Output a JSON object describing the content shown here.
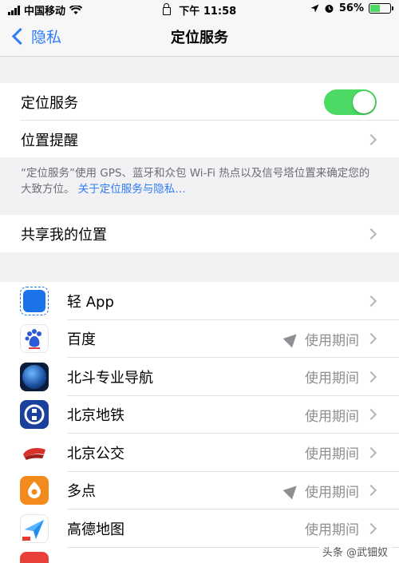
{
  "status_bar": {
    "carrier": "中国移动",
    "time": "下午 11:58",
    "battery": "56%",
    "battery_level": 0.56
  },
  "nav": {
    "back_label": "隐私",
    "title": "定位服务"
  },
  "location_section": {
    "toggle_label": "定位服务",
    "toggle_on": true,
    "reminder_label": "位置提醒"
  },
  "footnote": {
    "text": "“定位服务”使用 GPS、蓝牙和众包 Wi-Fi 热点以及信号塔位置来确定您的大致方位。",
    "link": "关于定位服务与隐私…"
  },
  "share_location": {
    "label": "共享我的位置"
  },
  "apps": [
    {
      "name": "轻 App",
      "status": "",
      "icon": "light-app-icon",
      "recent": false
    },
    {
      "name": "百度",
      "status": "使用期间",
      "icon": "baidu-icon",
      "recent": true
    },
    {
      "name": "北斗专业导航",
      "status": "使用期间",
      "icon": "beidou-icon",
      "recent": false
    },
    {
      "name": "北京地铁",
      "status": "使用期间",
      "icon": "beijing-subway-icon",
      "recent": false
    },
    {
      "name": "北京公交",
      "status": "使用期间",
      "icon": "beijing-bus-icon",
      "recent": false
    },
    {
      "name": "多点",
      "status": "使用期间",
      "icon": "duodian-icon",
      "recent": true
    },
    {
      "name": "高德地图",
      "status": "使用期间",
      "icon": "amap-icon",
      "recent": false
    },
    {
      "name": "",
      "status": "",
      "icon": "partial-app-icon",
      "recent": false
    }
  ],
  "watermark": "头条 @武钿奴"
}
